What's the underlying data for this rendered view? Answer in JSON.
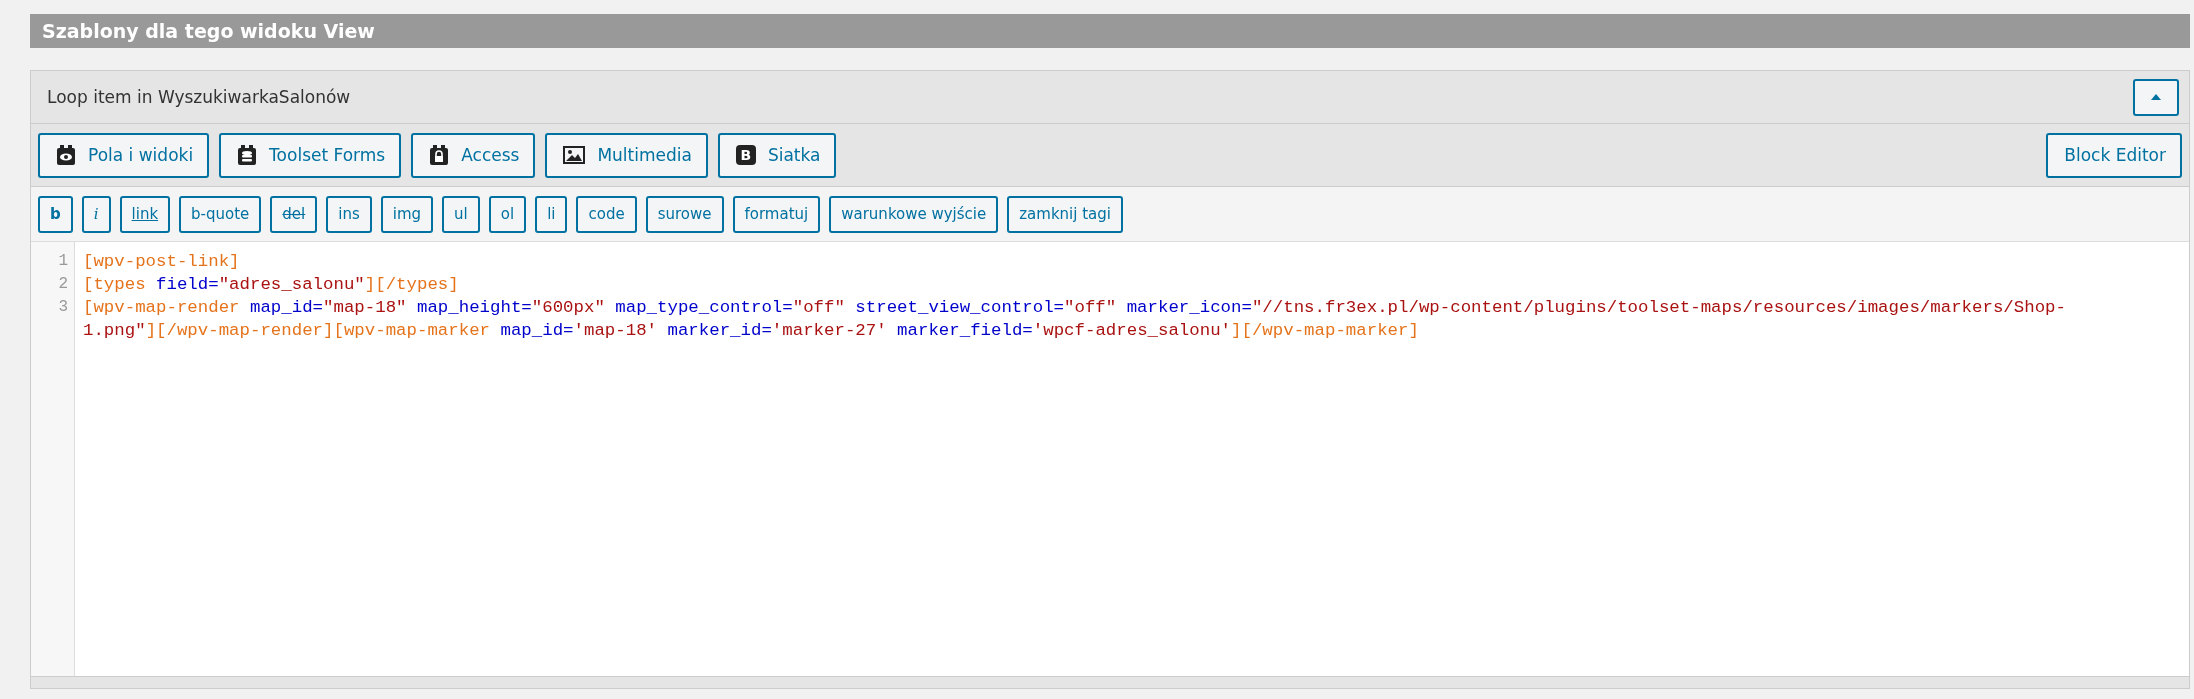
{
  "section_title": "Szablony dla tego widoku View",
  "panel": {
    "title": "Loop item in WyszukiwarkaSalonów",
    "collapsed": false,
    "toolbar": [
      {
        "label": "Pola i widoki",
        "kind": "eye"
      },
      {
        "label": "Toolset Forms",
        "kind": "database"
      },
      {
        "label": "Access",
        "kind": "lock"
      },
      {
        "label": "Multimedia",
        "kind": "image"
      },
      {
        "label": "Siatka",
        "kind": "letter",
        "icon_text": "B"
      }
    ],
    "toolbar_right": {
      "label": "Block Editor"
    },
    "quicktags": [
      {
        "label": "b",
        "kind": "bold"
      },
      {
        "label": "i",
        "kind": "italic"
      },
      {
        "label": "link",
        "kind": "underline"
      },
      {
        "label": "b-quote",
        "kind": "plain"
      },
      {
        "label": "del",
        "kind": "strike"
      },
      {
        "label": "ins",
        "kind": "plain"
      },
      {
        "label": "img",
        "kind": "plain"
      },
      {
        "label": "ul",
        "kind": "plain"
      },
      {
        "label": "ol",
        "kind": "plain"
      },
      {
        "label": "li",
        "kind": "plain"
      },
      {
        "label": "code",
        "kind": "plain"
      },
      {
        "label": "surowe",
        "kind": "plain"
      },
      {
        "label": "formatuj",
        "kind": "plain"
      },
      {
        "label": "warunkowe wyjście",
        "kind": "plain"
      },
      {
        "label": "zamknij tagi",
        "kind": "plain"
      }
    ],
    "code_lines": [
      {
        "number": "1",
        "rows": [
          "[wpv-post-link]"
        ]
      },
      {
        "number": "2",
        "rows": [
          "[types field=\"adres_salonu\"][/types]"
        ]
      },
      {
        "number": "3",
        "rows": [
          "[wpv-map-render map_id=\"map-18\" map_height=\"600px\" map_type_control=\"off\" street_view_control=\"off\" marker_icon=\"//tns.fr3ex.pl/wp-content/plugins/toolset-maps/resources/images/markers/Shop-",
          "1.png\"][/wpv-map-render][wpv-map-marker map_id='map-18' marker_id='marker-27' marker_field='wpcf-adres_salonu'][/wpv-map-marker]"
        ]
      }
    ]
  }
}
